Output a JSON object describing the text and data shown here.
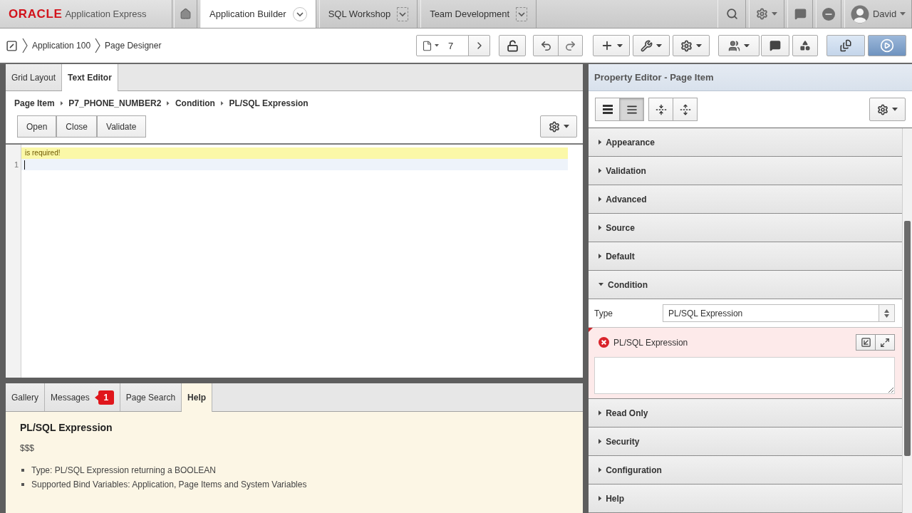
{
  "header": {
    "logo": {
      "brand": "ORACLE",
      "product": "Application Express"
    },
    "tabs": [
      {
        "kind": "home",
        "selected": false
      },
      {
        "kind": "menu",
        "label": "Application Builder",
        "selected": true
      },
      {
        "kind": "menu",
        "label": "SQL Workshop",
        "selected": false
      },
      {
        "kind": "menu",
        "label": "Team Development",
        "selected": false
      }
    ],
    "user": {
      "name": "David"
    }
  },
  "toolbar": {
    "breadcrumb": [
      "Application 100",
      "Page Designer"
    ],
    "page_number": "7"
  },
  "editor_panel": {
    "tabs": [
      {
        "label": "Grid Layout",
        "selected": false
      },
      {
        "label": "Text Editor",
        "selected": true
      }
    ],
    "breadcrumb": [
      "Page Item",
      "P7_PHONE_NUMBER2",
      "Condition",
      "PL/SQL Expression"
    ],
    "buttons": [
      "Open",
      "Close",
      "Validate"
    ],
    "code_editor": {
      "message": "is required!",
      "line_numbers": [
        "1"
      ]
    }
  },
  "bottom_panel": {
    "tabs": [
      {
        "label": "Gallery",
        "selected": false
      },
      {
        "label": "Messages",
        "selected": false,
        "badge": "1"
      },
      {
        "label": "Page Search",
        "selected": false
      },
      {
        "label": "Help",
        "selected": true
      }
    ],
    "help": {
      "title": "PL/SQL Expression",
      "text": "$$$",
      "bullets": [
        "Type: PL/SQL Expression returning a BOOLEAN",
        "Supported Bind Variables: Application, Page Items and System Variables"
      ]
    }
  },
  "property_editor": {
    "title": "Property Editor - Page Item",
    "view_buttons": [
      {
        "selected": false
      },
      {
        "selected": true
      },
      {
        "selected": false
      },
      {
        "selected": false
      }
    ],
    "groups": [
      {
        "label": "Appearance",
        "expanded": false
      },
      {
        "label": "Validation",
        "expanded": false
      },
      {
        "label": "Advanced",
        "expanded": false
      },
      {
        "label": "Source",
        "expanded": false
      },
      {
        "label": "Default",
        "expanded": false
      },
      {
        "label": "Condition",
        "expanded": true,
        "properties": [
          {
            "kind": "select",
            "label": "Type",
            "value": "PL/SQL Expression"
          },
          {
            "kind": "code",
            "label": "PL/SQL Expression",
            "error": true
          }
        ]
      },
      {
        "label": "Read Only",
        "expanded": false
      },
      {
        "label": "Security",
        "expanded": false
      },
      {
        "label": "Configuration",
        "expanded": false
      },
      {
        "label": "Help",
        "expanded": false
      }
    ]
  }
}
